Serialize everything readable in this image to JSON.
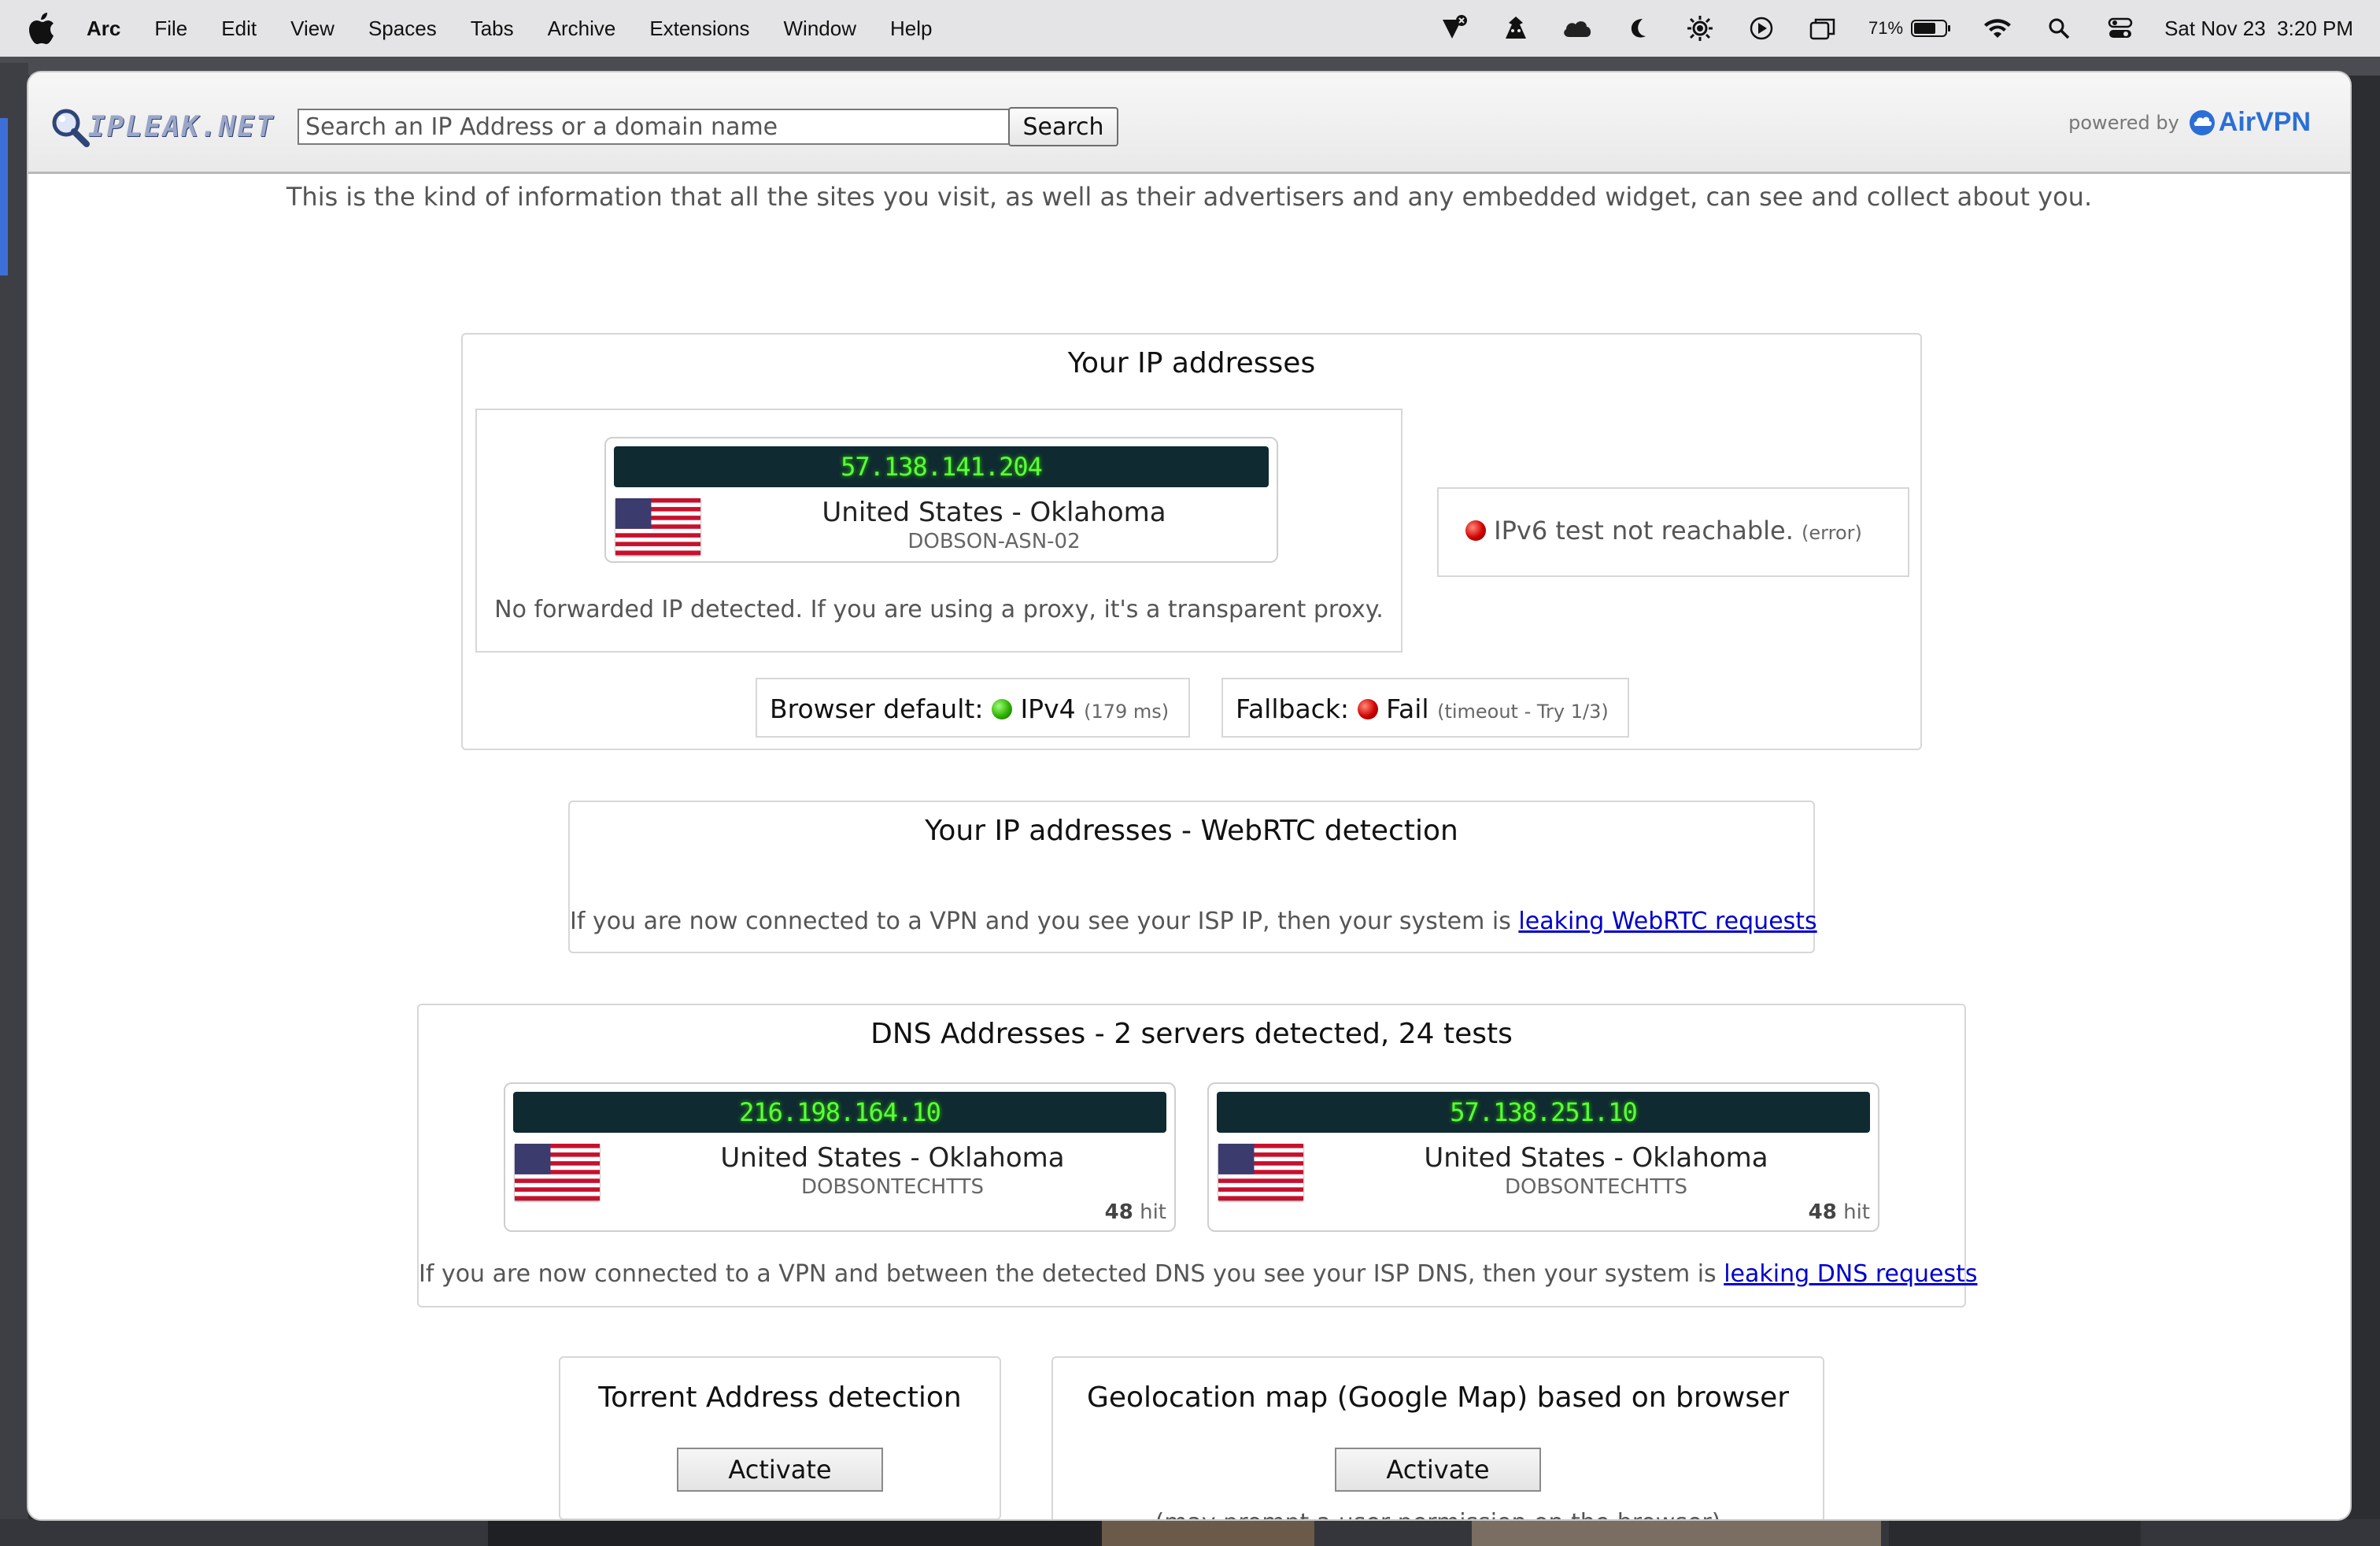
{
  "menubar": {
    "app": "Arc",
    "items": [
      "File",
      "Edit",
      "View",
      "Spaces",
      "Tabs",
      "Archive",
      "Extensions",
      "Window",
      "Help"
    ],
    "battery_pct": "71%",
    "battery_level": 0.71,
    "date": "Sat Nov 23",
    "time": "3:20 PM",
    "tray_icons": [
      "vpn-icon",
      "agent-icon",
      "cloud-icon",
      "moon-icon",
      "sun-icon",
      "play-icon",
      "windows-icon",
      "battery-icon",
      "wifi-icon",
      "search-icon",
      "control-center-icon"
    ]
  },
  "site": {
    "logo_text": "IPLEAK.NET",
    "search_placeholder": "Search an IP Address or a domain name",
    "search_button": "Search",
    "powered_by": "powered by",
    "brand": "AirVPN"
  },
  "intro": "This is the kind of information that all the sites you visit, as well as their advertisers and any embedded widget, can see and collect about you.",
  "ip_section": {
    "title": "Your IP addresses",
    "ip": "57.138.141.204",
    "location": "United States - Oklahoma",
    "isp": "DOBSON-ASN-02",
    "forward_note": "No forwarded IP detected. If you are using a proxy, it's a transparent proxy.",
    "ipv6_text": "IPv6 test not reachable.",
    "ipv6_small": "(error)",
    "browser_default_label": "Browser default:",
    "browser_default_value": "IPv4",
    "browser_default_small": "(179 ms)",
    "fallback_label": "Fallback:",
    "fallback_value": "Fail",
    "fallback_small": "(timeout - Try 1/3)"
  },
  "webrtc": {
    "title": "Your IP addresses - WebRTC detection",
    "note": "If you are now connected to a VPN and you see your ISP IP, then your system is",
    "link": "leaking WebRTC requests"
  },
  "dns": {
    "title": "DNS Addresses - 2 servers detected, 24 tests",
    "servers": [
      {
        "ip": "216.198.164.10",
        "location": "United States - Oklahoma",
        "isp": "DOBSONTECHTTS",
        "hits": "48",
        "hit_label": "hit"
      },
      {
        "ip": "57.138.251.10",
        "location": "United States - Oklahoma",
        "isp": "DOBSONTECHTTS",
        "hits": "48",
        "hit_label": "hit"
      }
    ],
    "note": "If you are now connected to a VPN and between the detected DNS you see your ISP DNS, then your system is",
    "link": "leaking DNS requests"
  },
  "torrent": {
    "title": "Torrent Address detection",
    "button": "Activate"
  },
  "geo": {
    "title": "Geolocation map (Google Map) based on browser",
    "button": "Activate",
    "note": "(may prompt a user permission on the browser)"
  }
}
